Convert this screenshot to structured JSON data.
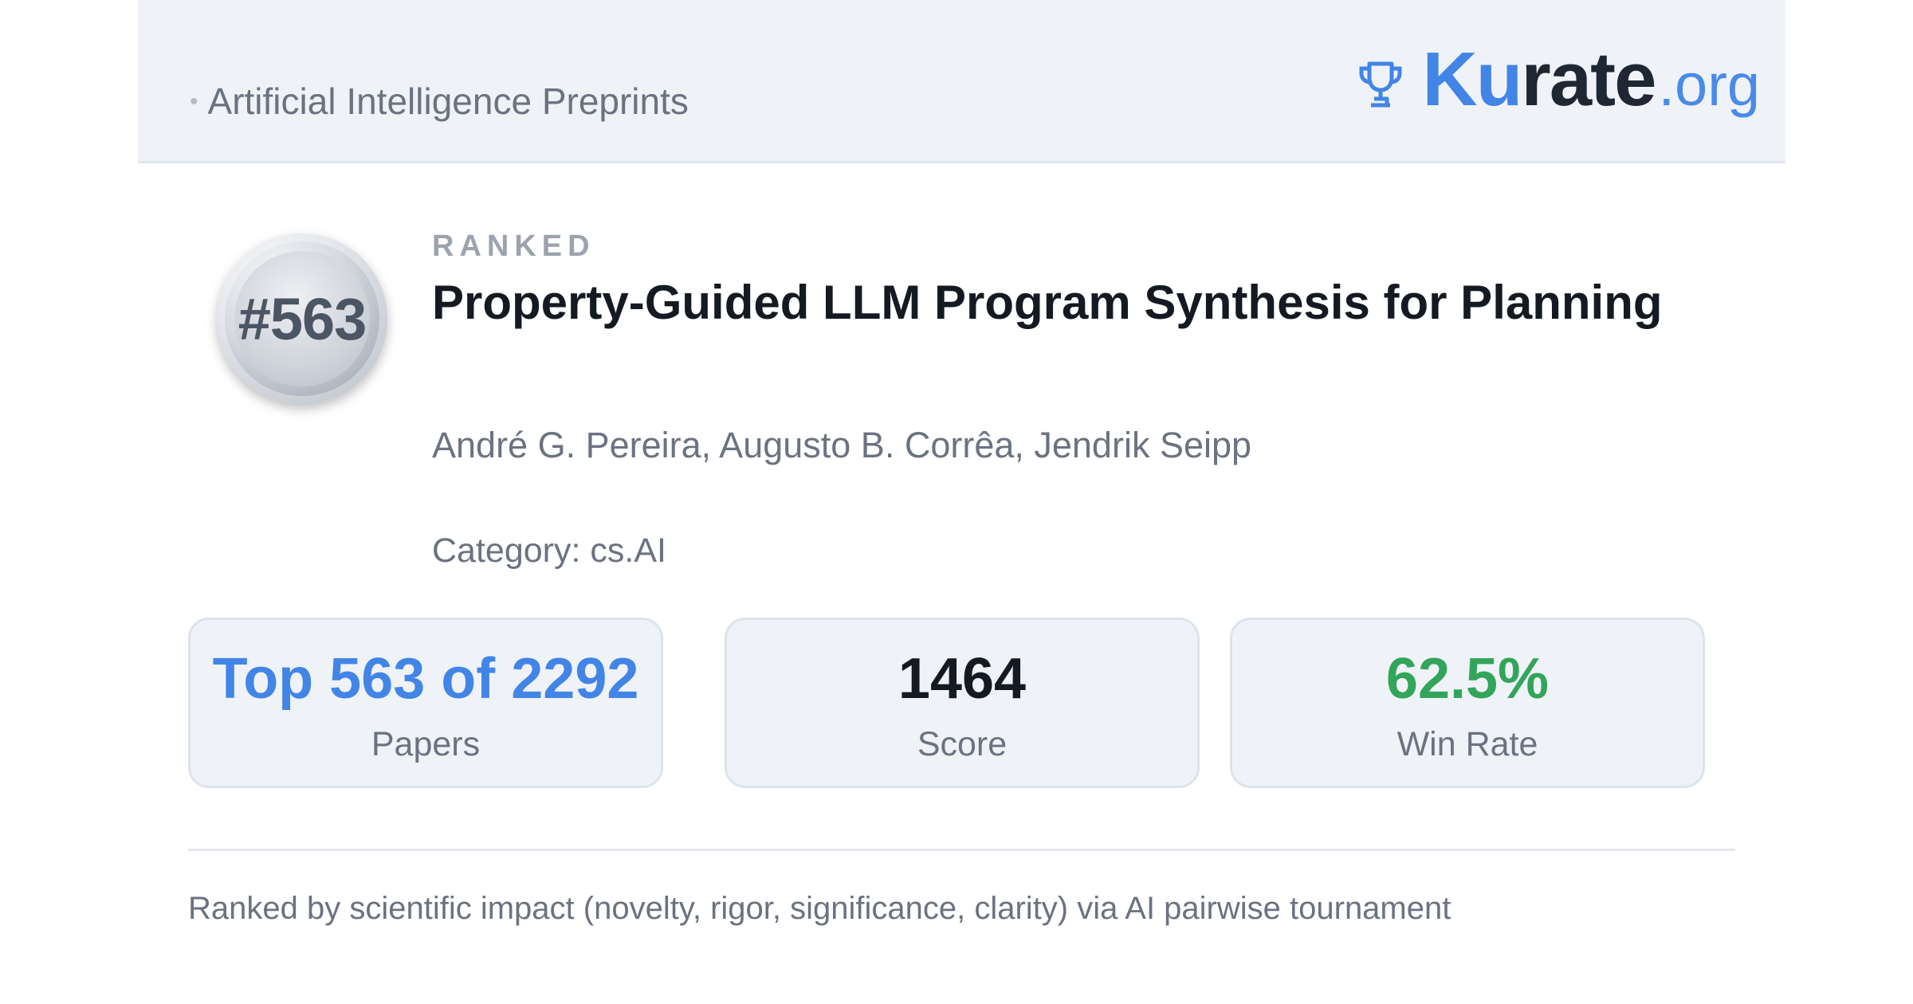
{
  "header": {
    "subtitle": "Artificial Intelligence Preprints",
    "brand": {
      "ku": "Ku",
      "rate": "rate",
      "tld": ".org"
    }
  },
  "badge": {
    "rank": "#563"
  },
  "paper": {
    "ranked_label": "RANKED",
    "title": "Property-Guided LLM Program Synthesis for Planning",
    "authors": "André G. Pereira, Augusto B. Corrêa, Jendrik Seipp",
    "category": "Category: cs.AI"
  },
  "stats": [
    {
      "value": "Top 563 of 2292",
      "label": "Papers",
      "color": "#4285e6"
    },
    {
      "value": "1464",
      "label": "Score",
      "color": "#151a22"
    },
    {
      "value": "62.5%",
      "label": "Win Rate",
      "color": "#33a55a"
    }
  ],
  "footer": {
    "note": "Ranked by scientific impact (novelty, rigor, significance, clarity) via AI pairwise tournament"
  },
  "icons": {
    "brand_icon": "trophy-icon",
    "separator": "dot-icon"
  }
}
